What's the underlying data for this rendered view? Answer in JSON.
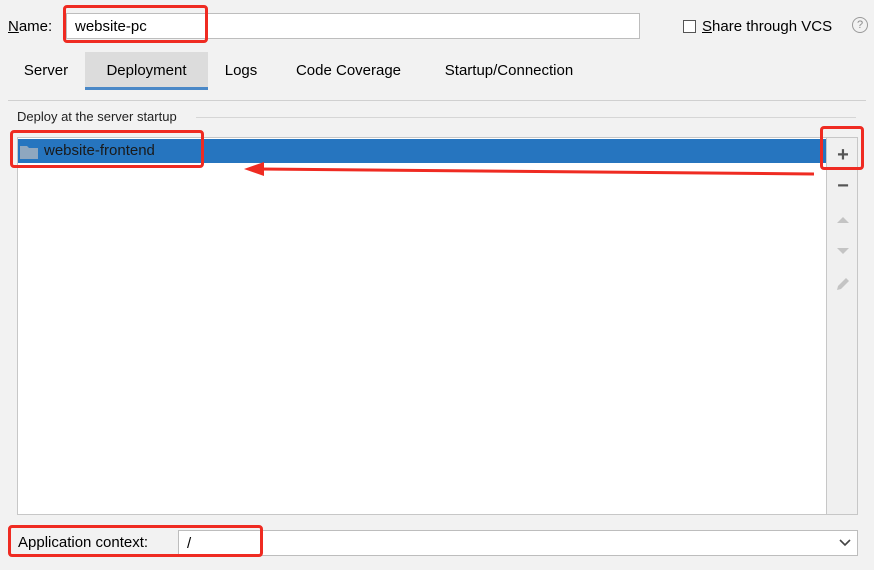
{
  "name_field": {
    "label_underlined": "N",
    "label_rest": "ame:",
    "value": "website-pc"
  },
  "vcs": {
    "label_underlined": "S",
    "label_rest": "hare through VCS",
    "checked": false
  },
  "help": {
    "glyph": "?"
  },
  "tabs": [
    {
      "label": "Server",
      "active": false
    },
    {
      "label": "Deployment",
      "active": true
    },
    {
      "label": "Logs",
      "active": false
    },
    {
      "label": "Code Coverage",
      "active": false
    },
    {
      "label": "Startup/Connection",
      "active": false
    }
  ],
  "deploy": {
    "title": "Deploy at the server startup",
    "items": [
      {
        "label": "website-frontend",
        "icon": "folder-icon",
        "selected": true
      }
    ]
  },
  "toolbar": {
    "add_glyph": "+",
    "remove_glyph": "−",
    "icons": [
      "plus-icon",
      "minus-icon",
      "move-up-icon",
      "move-down-icon",
      "edit-icon"
    ]
  },
  "context": {
    "label": "Application context:",
    "value": "/"
  },
  "colors": {
    "selection": "#2675bf",
    "annotation": "#ef2b22",
    "tab_underline": "#4a88c7"
  }
}
